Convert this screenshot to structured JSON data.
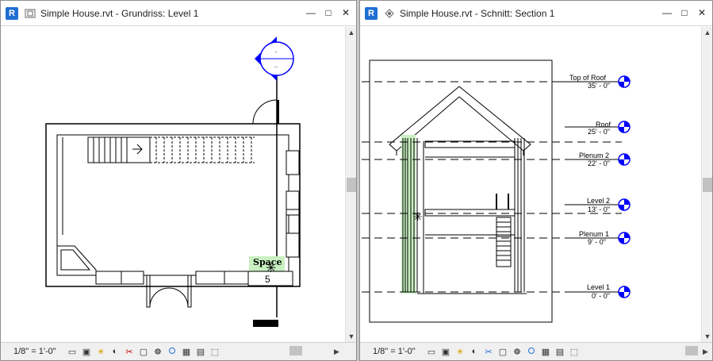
{
  "left_pane": {
    "app_icon": "R",
    "title": "Simple House.rvt - Grundriss: Level 1",
    "scale": "1/8\" = 1'-0\"",
    "space_tag": {
      "name": "Space",
      "number": "5"
    },
    "elevation_marker": {
      "top": "-",
      "bottom": "..."
    }
  },
  "right_pane": {
    "app_icon": "R",
    "title": "Simple House.rvt - Schnitt: Section 1",
    "scale": "1/8\" = 1'-0\"",
    "levels": [
      {
        "name": "Top of Roof",
        "elevation": "35' - 0\""
      },
      {
        "name": "Roof",
        "elevation": "25' - 0\""
      },
      {
        "name": "Plenum 2",
        "elevation": "22' - 0\""
      },
      {
        "name": "Level 2",
        "elevation": "13' - 0\""
      },
      {
        "name": "Plenum 1",
        "elevation": "9' - 0\""
      },
      {
        "name": "Level 1",
        "elevation": "0' - 0\""
      }
    ]
  },
  "icons": {
    "view_controls_left": [
      "detail-level-icon",
      "visual-style-icon",
      "sun-path-icon",
      "shadows-icon",
      "crop-view-icon",
      "show-crop-icon",
      "temporary-hide-icon",
      "reveal-hidden-icon",
      "analytical-model-icon",
      "highlight-displacement-icon",
      "reveal-constraints-icon",
      "temporary-view-properties-icon"
    ]
  },
  "colors": {
    "accent_blue": "#1f6fd1",
    "marker_blue": "#0000ff",
    "space_fill": "#c8f0c0"
  }
}
